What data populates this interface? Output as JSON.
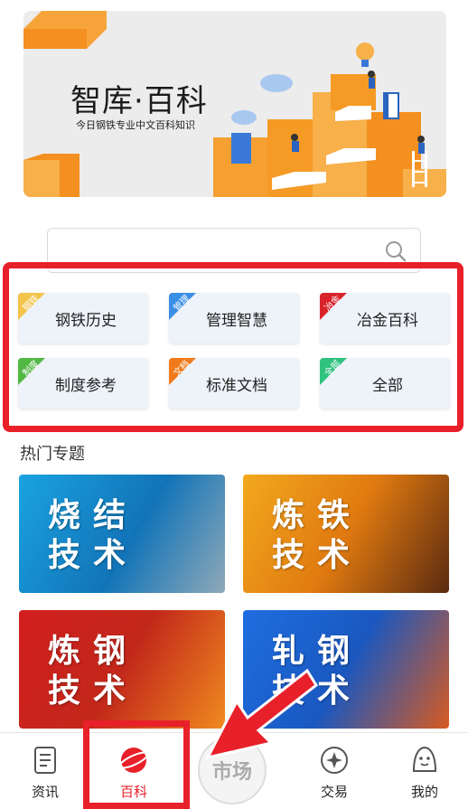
{
  "banner": {
    "title": "智库·百科",
    "subtitle": "今日钢铁专业中文百科知识"
  },
  "search": {
    "placeholder": ""
  },
  "categories": [
    {
      "label": "钢铁历史",
      "tag": "钢铁",
      "tag_color": "#f2c44a"
    },
    {
      "label": "管理智慧",
      "tag": "管理",
      "tag_color": "#3a8ee6"
    },
    {
      "label": "冶金百科",
      "tag": "冶金",
      "tag_color": "#d9232a"
    },
    {
      "label": "制度参考",
      "tag": "制度",
      "tag_color": "#52b844"
    },
    {
      "label": "标准文档",
      "tag": "文档",
      "tag_color": "#f07a1a"
    },
    {
      "label": "全部",
      "tag": "全部",
      "tag_color": "#2ec27e"
    }
  ],
  "hot": {
    "title": "热门专题",
    "tiles": [
      {
        "line1": "烧结",
        "line2": "技术",
        "bg": "#1a8fd0"
      },
      {
        "line1": "炼铁",
        "line2": "技术",
        "bg": "#f0a020"
      },
      {
        "line1": "炼钢",
        "line2": "技术",
        "bg": "#d7261e"
      },
      {
        "line1": "轧钢",
        "line2": "技术",
        "bg": "#1e5fc8"
      }
    ]
  },
  "nav": {
    "news": "资讯",
    "wiki": "百科",
    "market": "市场",
    "trade": "交易",
    "mine": "我的",
    "active_color": "#e8202a"
  }
}
